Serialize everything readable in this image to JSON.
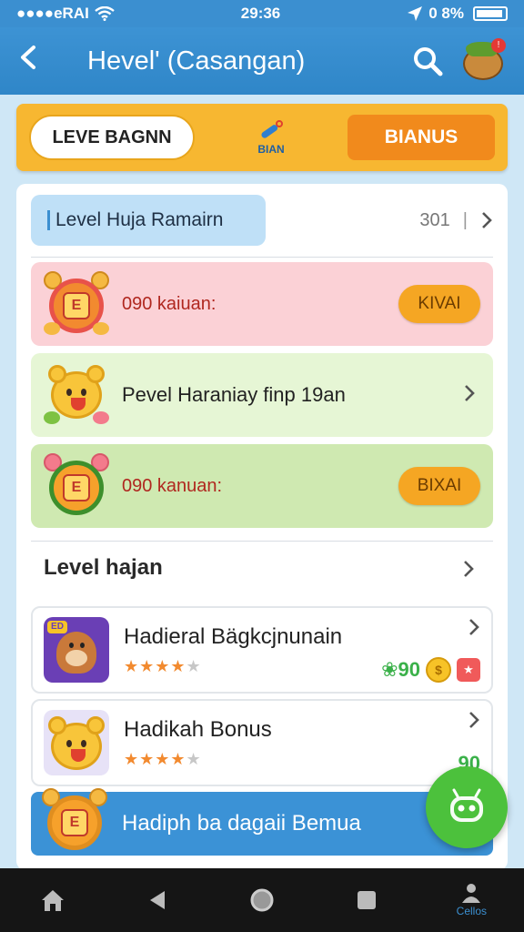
{
  "status_bar": {
    "carrier": "●●●●eRAI",
    "time": "29:36",
    "battery": "0 8%"
  },
  "app_bar": {
    "title": "Hevel' (Casangan)"
  },
  "tabs": {
    "level": "LEVE BAGNN",
    "middle": "BIAN",
    "bonus": "BIANUS"
  },
  "section": {
    "title": "Level Huja Ramairn",
    "count": "301"
  },
  "rows": [
    {
      "label": "090 kaiuan:",
      "button": "KIVAI"
    },
    {
      "label": "Pevel Haraniay finp 19an"
    },
    {
      "label": "090 kanuan:",
      "button": "BIXAI"
    }
  ],
  "subsection": {
    "title": "Level hajan"
  },
  "games": [
    {
      "title": "Hadieral Bägkcjnunain",
      "points": "❀90",
      "stars_on": 4,
      "stars_total": 5
    },
    {
      "title": "Hadikah Bonus",
      "points": "90",
      "stars_on": 4,
      "stars_total": 5
    }
  ],
  "banner": {
    "label": "Hadiph ba dagaii Bemua"
  },
  "nav": {
    "profile_label": "Cellos"
  },
  "colors": {
    "primary": "#3b8fd0",
    "accent": "#f7b731",
    "bonus": "#f18a1c",
    "fab": "#4cc13c"
  }
}
